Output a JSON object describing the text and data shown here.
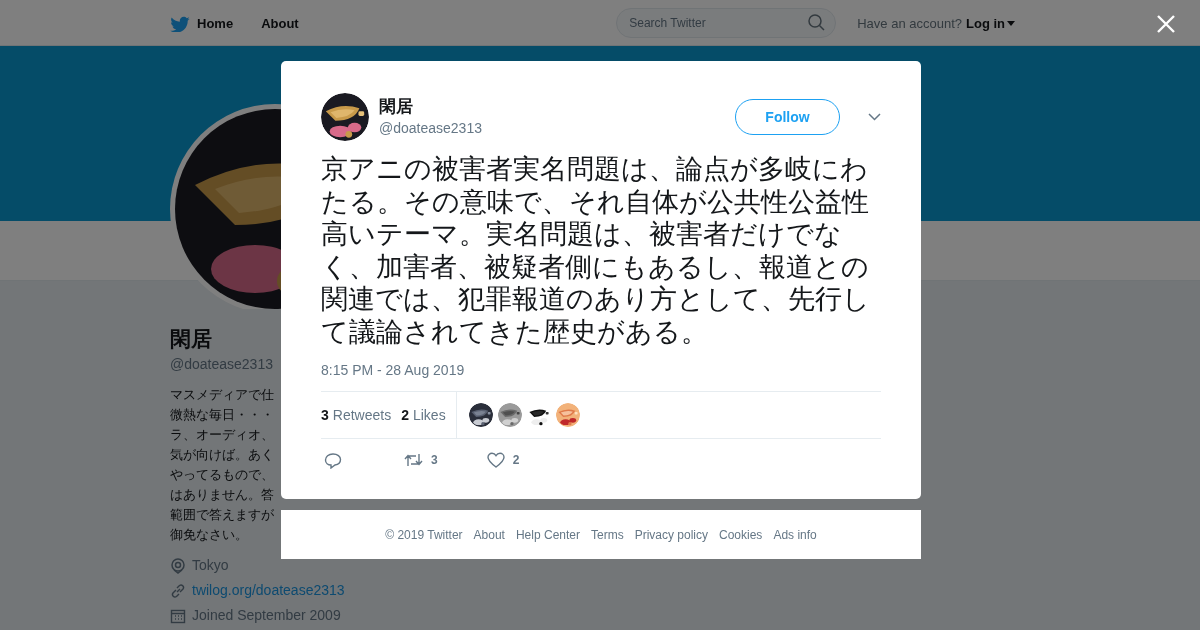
{
  "topbar": {
    "home": "Home",
    "about": "About",
    "search_placeholder": "Search Twitter",
    "have_account": "Have an account?",
    "login": "Log in"
  },
  "profile": {
    "name": "閑居",
    "handle": "@doatease2313",
    "bio_lines": [
      "マスメディアで仕",
      "微熱な毎日・・・",
      "ラ、オーディオ、",
      "気が向けば。あく",
      "やってるもので、",
      "はありません。答",
      "範囲で答えますが",
      "御免なさい。"
    ],
    "location": "Tokyo",
    "url": "twilog.org/doatease2313",
    "joined": "Joined September 2009"
  },
  "tweet": {
    "name": "閑居",
    "handle": "@doatease2313",
    "follow": "Follow",
    "text": "京アニの被害者実名問題は、論点が多岐にわたる。その意味で、それ自体が公共性公益性高いテーマ。実名問題は、被害者だけでなく、加害者、被疑者側にもあるし、報道との関連では、犯罪報道のあり方として、先行して議論されてきた歴史がある。",
    "time": "8:15 PM - 28 Aug 2019",
    "retweets_count": "3",
    "retweets_label": "Retweets",
    "likes_count": "2",
    "likes_label": "Likes",
    "retweet_action_count": "3",
    "like_action_count": "2"
  },
  "footer": {
    "links": [
      "© 2019 Twitter",
      "About",
      "Help Center",
      "Terms",
      "Privacy policy",
      "Cookies",
      "Ads info"
    ]
  }
}
